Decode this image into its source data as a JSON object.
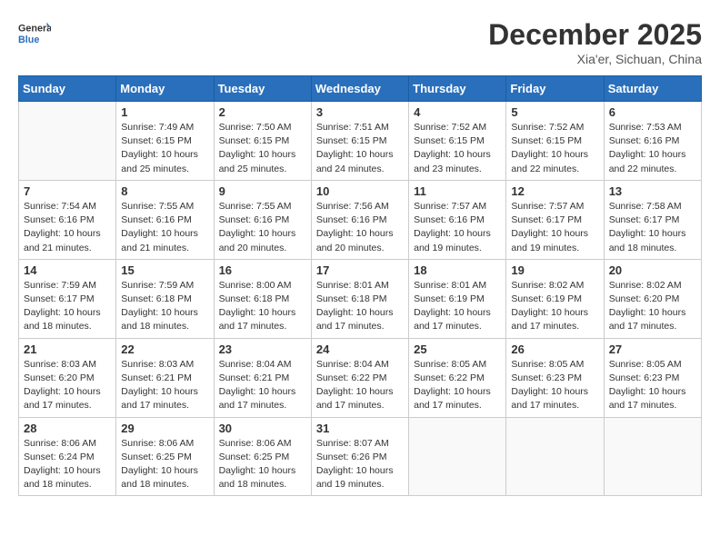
{
  "header": {
    "logo_line1": "General",
    "logo_line2": "Blue",
    "month_year": "December 2025",
    "location": "Xia'er, Sichuan, China"
  },
  "weekdays": [
    "Sunday",
    "Monday",
    "Tuesday",
    "Wednesday",
    "Thursday",
    "Friday",
    "Saturday"
  ],
  "weeks": [
    [
      {
        "day": "",
        "info": ""
      },
      {
        "day": "1",
        "info": "Sunrise: 7:49 AM\nSunset: 6:15 PM\nDaylight: 10 hours\nand 25 minutes."
      },
      {
        "day": "2",
        "info": "Sunrise: 7:50 AM\nSunset: 6:15 PM\nDaylight: 10 hours\nand 25 minutes."
      },
      {
        "day": "3",
        "info": "Sunrise: 7:51 AM\nSunset: 6:15 PM\nDaylight: 10 hours\nand 24 minutes."
      },
      {
        "day": "4",
        "info": "Sunrise: 7:52 AM\nSunset: 6:15 PM\nDaylight: 10 hours\nand 23 minutes."
      },
      {
        "day": "5",
        "info": "Sunrise: 7:52 AM\nSunset: 6:15 PM\nDaylight: 10 hours\nand 22 minutes."
      },
      {
        "day": "6",
        "info": "Sunrise: 7:53 AM\nSunset: 6:16 PM\nDaylight: 10 hours\nand 22 minutes."
      }
    ],
    [
      {
        "day": "7",
        "info": "Sunrise: 7:54 AM\nSunset: 6:16 PM\nDaylight: 10 hours\nand 21 minutes."
      },
      {
        "day": "8",
        "info": "Sunrise: 7:55 AM\nSunset: 6:16 PM\nDaylight: 10 hours\nand 21 minutes."
      },
      {
        "day": "9",
        "info": "Sunrise: 7:55 AM\nSunset: 6:16 PM\nDaylight: 10 hours\nand 20 minutes."
      },
      {
        "day": "10",
        "info": "Sunrise: 7:56 AM\nSunset: 6:16 PM\nDaylight: 10 hours\nand 20 minutes."
      },
      {
        "day": "11",
        "info": "Sunrise: 7:57 AM\nSunset: 6:16 PM\nDaylight: 10 hours\nand 19 minutes."
      },
      {
        "day": "12",
        "info": "Sunrise: 7:57 AM\nSunset: 6:17 PM\nDaylight: 10 hours\nand 19 minutes."
      },
      {
        "day": "13",
        "info": "Sunrise: 7:58 AM\nSunset: 6:17 PM\nDaylight: 10 hours\nand 18 minutes."
      }
    ],
    [
      {
        "day": "14",
        "info": "Sunrise: 7:59 AM\nSunset: 6:17 PM\nDaylight: 10 hours\nand 18 minutes."
      },
      {
        "day": "15",
        "info": "Sunrise: 7:59 AM\nSunset: 6:18 PM\nDaylight: 10 hours\nand 18 minutes."
      },
      {
        "day": "16",
        "info": "Sunrise: 8:00 AM\nSunset: 6:18 PM\nDaylight: 10 hours\nand 17 minutes."
      },
      {
        "day": "17",
        "info": "Sunrise: 8:01 AM\nSunset: 6:18 PM\nDaylight: 10 hours\nand 17 minutes."
      },
      {
        "day": "18",
        "info": "Sunrise: 8:01 AM\nSunset: 6:19 PM\nDaylight: 10 hours\nand 17 minutes."
      },
      {
        "day": "19",
        "info": "Sunrise: 8:02 AM\nSunset: 6:19 PM\nDaylight: 10 hours\nand 17 minutes."
      },
      {
        "day": "20",
        "info": "Sunrise: 8:02 AM\nSunset: 6:20 PM\nDaylight: 10 hours\nand 17 minutes."
      }
    ],
    [
      {
        "day": "21",
        "info": "Sunrise: 8:03 AM\nSunset: 6:20 PM\nDaylight: 10 hours\nand 17 minutes."
      },
      {
        "day": "22",
        "info": "Sunrise: 8:03 AM\nSunset: 6:21 PM\nDaylight: 10 hours\nand 17 minutes."
      },
      {
        "day": "23",
        "info": "Sunrise: 8:04 AM\nSunset: 6:21 PM\nDaylight: 10 hours\nand 17 minutes."
      },
      {
        "day": "24",
        "info": "Sunrise: 8:04 AM\nSunset: 6:22 PM\nDaylight: 10 hours\nand 17 minutes."
      },
      {
        "day": "25",
        "info": "Sunrise: 8:05 AM\nSunset: 6:22 PM\nDaylight: 10 hours\nand 17 minutes."
      },
      {
        "day": "26",
        "info": "Sunrise: 8:05 AM\nSunset: 6:23 PM\nDaylight: 10 hours\nand 17 minutes."
      },
      {
        "day": "27",
        "info": "Sunrise: 8:05 AM\nSunset: 6:23 PM\nDaylight: 10 hours\nand 17 minutes."
      }
    ],
    [
      {
        "day": "28",
        "info": "Sunrise: 8:06 AM\nSunset: 6:24 PM\nDaylight: 10 hours\nand 18 minutes."
      },
      {
        "day": "29",
        "info": "Sunrise: 8:06 AM\nSunset: 6:25 PM\nDaylight: 10 hours\nand 18 minutes."
      },
      {
        "day": "30",
        "info": "Sunrise: 8:06 AM\nSunset: 6:25 PM\nDaylight: 10 hours\nand 18 minutes."
      },
      {
        "day": "31",
        "info": "Sunrise: 8:07 AM\nSunset: 6:26 PM\nDaylight: 10 hours\nand 19 minutes."
      },
      {
        "day": "",
        "info": ""
      },
      {
        "day": "",
        "info": ""
      },
      {
        "day": "",
        "info": ""
      }
    ]
  ]
}
